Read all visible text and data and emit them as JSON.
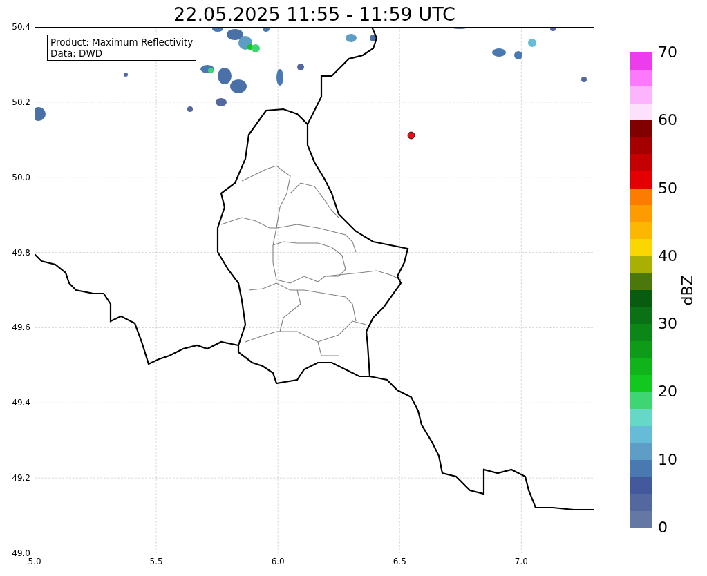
{
  "title": "22.05.2025 11:55 - 11:59 UTC",
  "map": {
    "info_box": [
      "Product: Maximum Reflectivity",
      "Data: DWD"
    ],
    "xticks": [
      "5.0",
      "5.5",
      "6.0",
      "6.5",
      "7.0"
    ],
    "yticks": [
      "50.4",
      "50.2",
      "50.0",
      "49.8",
      "49.6",
      "49.4",
      "49.2",
      "49.0"
    ]
  },
  "colorbar": {
    "label": "dBZ",
    "ticks": [
      "70",
      "60",
      "50",
      "40",
      "30",
      "20",
      "10",
      "0"
    ],
    "segments": [
      {
        "color": "#ec3cec"
      },
      {
        "color": "#fc78fc"
      },
      {
        "color": "#fcb4fc"
      },
      {
        "color": "#fde0fc"
      },
      {
        "color": "#800000"
      },
      {
        "color": "#a40000"
      },
      {
        "color": "#c40000"
      },
      {
        "color": "#e40000"
      },
      {
        "color": "#fc7c00"
      },
      {
        "color": "#fc9c00"
      },
      {
        "color": "#fcb800"
      },
      {
        "color": "#fcd600"
      },
      {
        "color": "#a8b004"
      },
      {
        "color": "#4a780a"
      },
      {
        "color": "#085c10"
      },
      {
        "color": "#0a7214"
      },
      {
        "color": "#0c8616"
      },
      {
        "color": "#0e9c18"
      },
      {
        "color": "#10b41a"
      },
      {
        "color": "#12c81e"
      },
      {
        "color": "#3ed672"
      },
      {
        "color": "#66d8c8"
      },
      {
        "color": "#66bcd6"
      },
      {
        "color": "#5e9ec6"
      },
      {
        "color": "#4a78b0"
      },
      {
        "color": "#42599b"
      },
      {
        "color": "#5468a0"
      },
      {
        "color": "#6478a6"
      }
    ]
  }
}
